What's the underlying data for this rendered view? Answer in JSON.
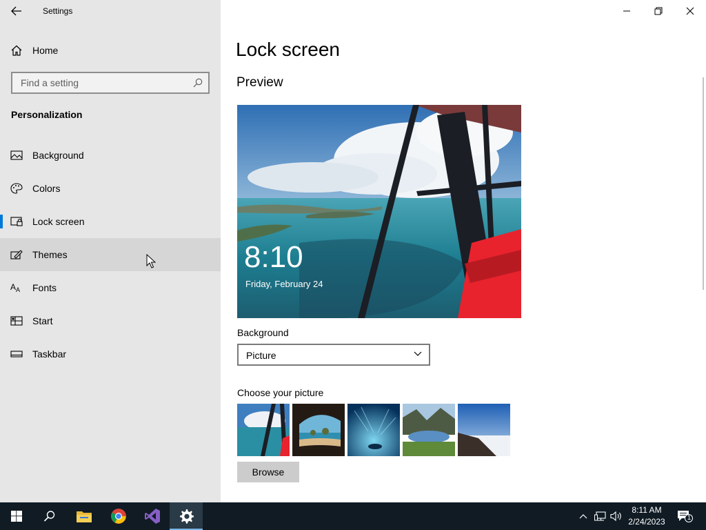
{
  "window": {
    "app_title": "Settings",
    "controls": [
      "minimize-icon",
      "restore-icon",
      "close-icon"
    ]
  },
  "sidebar": {
    "home_label": "Home",
    "search": {
      "placeholder": "Find a setting",
      "value": ""
    },
    "section_title": "Personalization",
    "items": [
      {
        "label": "Background",
        "icon": "picture-icon"
      },
      {
        "label": "Colors",
        "icon": "palette-icon"
      },
      {
        "label": "Lock screen",
        "icon": "lock-screen-icon",
        "selected": true
      },
      {
        "label": "Themes",
        "icon": "themes-icon",
        "hovered": true
      },
      {
        "label": "Fonts",
        "icon": "fonts-icon"
      },
      {
        "label": "Start",
        "icon": "start-icon"
      },
      {
        "label": "Taskbar",
        "icon": "taskbar-icon"
      }
    ],
    "accent_color": "#0078d7"
  },
  "main": {
    "title": "Lock screen",
    "preview_heading": "Preview",
    "preview": {
      "time": "8:10",
      "date": "Friday, February 24"
    },
    "background_label": "Background",
    "background_value": "Picture",
    "choose_picture_label": "Choose your picture",
    "thumbnails": [
      "plane-wing-ocean",
      "cave-beach",
      "underwater-blue",
      "mountain-lake",
      "cliff-clouds"
    ],
    "browse_label": "Browse"
  },
  "taskbar": {
    "apps": [
      "windows-start-icon",
      "search-icon",
      "file-explorer-icon",
      "chrome-icon",
      "visual-studio-icon",
      "settings-gear-icon"
    ],
    "active_app": "settings-gear-icon",
    "clock_time": "8:11 AM",
    "clock_date": "2/24/2023",
    "notification_count": "1"
  }
}
